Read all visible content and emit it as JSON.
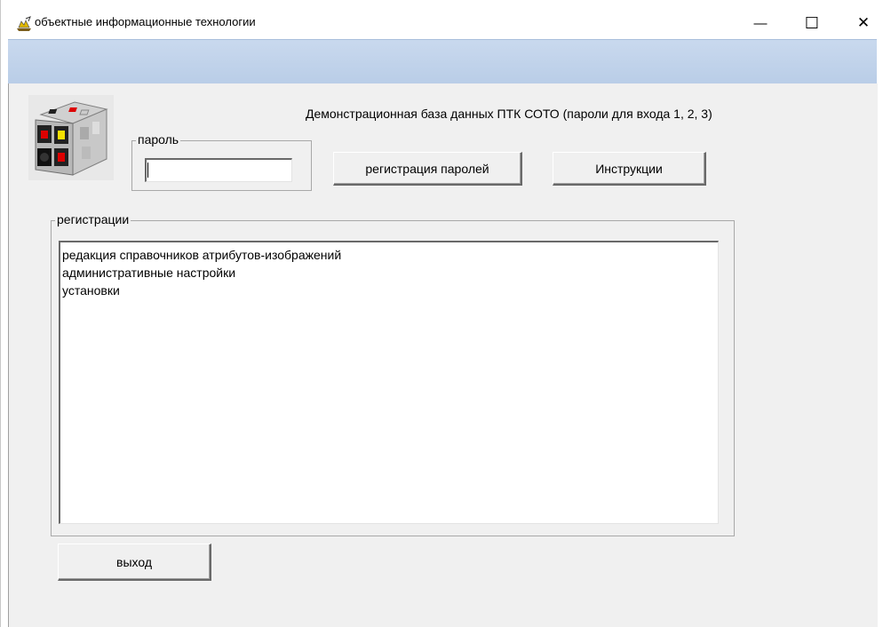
{
  "window": {
    "title": "объектные информационные технологии",
    "minimize_glyph": "—",
    "maximize_glyph": "☐",
    "close_glyph": "✕"
  },
  "header": {
    "text": "Демонстрационная база данных ПТК СОТО (пароли для входа 1, 2, 3)"
  },
  "password": {
    "group_label": "пароль",
    "value": "",
    "placeholder": ""
  },
  "buttons": {
    "register_passwords": "регистрация паролей",
    "instructions": "Инструкции",
    "exit": "выход"
  },
  "registrations": {
    "group_label": "регистрации",
    "items": [
      "редакция справочников атрибутов-изображений",
      "административные настройки",
      "установки"
    ]
  },
  "colors": {
    "menubar": "#c9d9ee",
    "client_bg": "#f0f0f0"
  }
}
